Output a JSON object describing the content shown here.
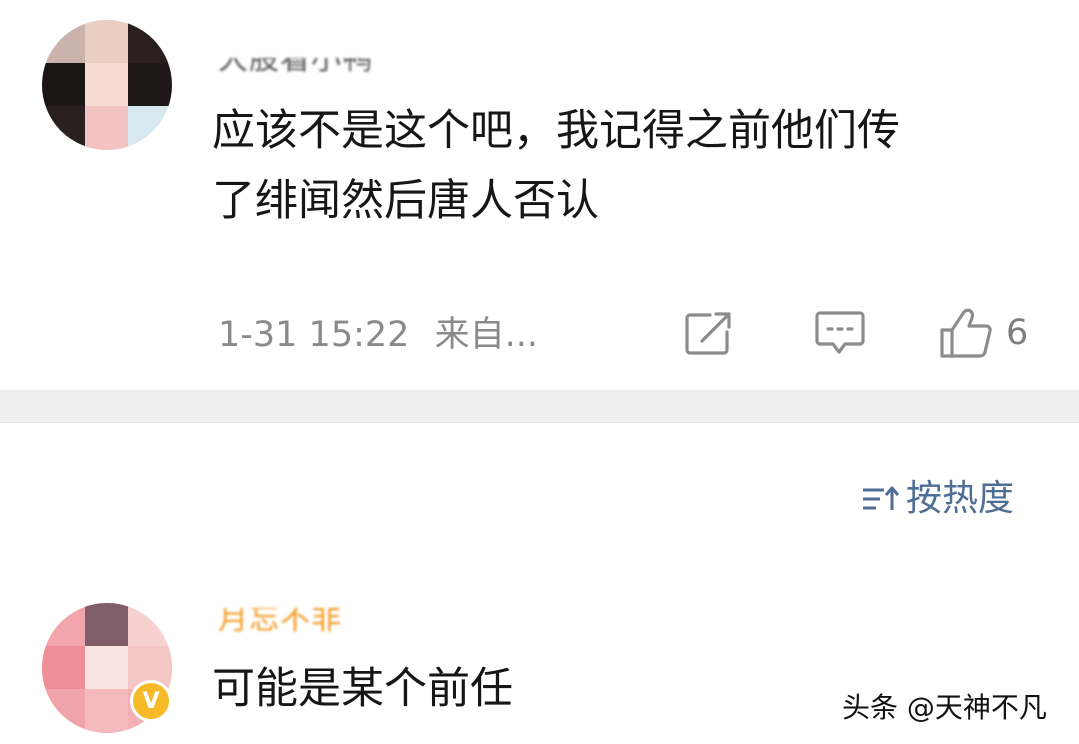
{
  "comment_1": {
    "username": "大股看小鸭",
    "text": "应该不是这个吧，我记得之前他们传\n了绯闻然后唐人否认",
    "timestamp": "1-31 15:22",
    "source": "来自...",
    "like_count": "6"
  },
  "sort": {
    "label": "按热度"
  },
  "comment_2": {
    "username": "月忘不非",
    "text": "可能是某个前任"
  },
  "watermark": "头条 @天神不凡",
  "colors": {
    "link_blue": "#4f6e93",
    "vip_orange": "#f6b928",
    "username_orange": "#f29a1f",
    "divider_gray": "#efefef",
    "meta_gray": "#8a8a8a"
  },
  "icons": {
    "share": "share-icon",
    "reply": "comment-icon",
    "like": "thumbs-up-icon",
    "sort": "sort-icon",
    "vip": "vip-badge-icon"
  }
}
